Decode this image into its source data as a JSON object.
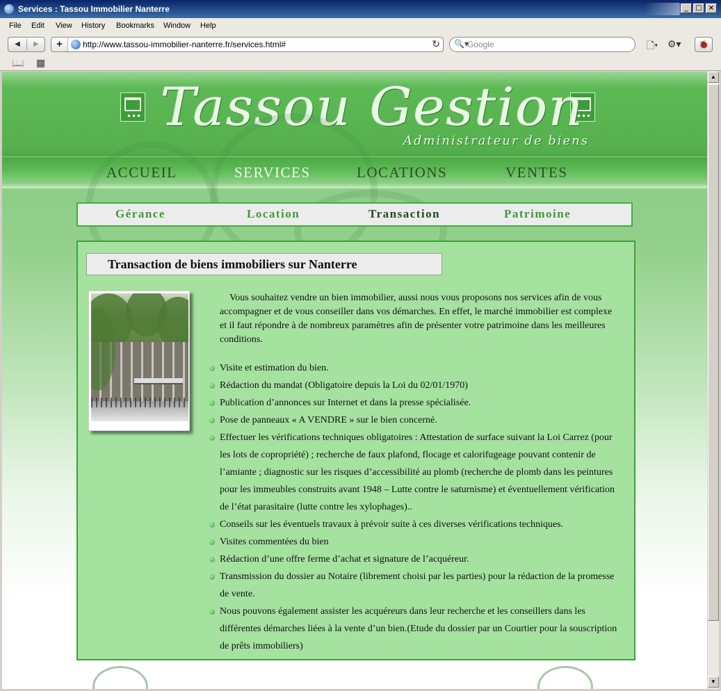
{
  "window": {
    "title": "Services : Tassou Immobilier Nanterre",
    "controls": {
      "minimize": "_",
      "maximize": "□",
      "close": "×"
    }
  },
  "menu": [
    "File",
    "Edit",
    "View",
    "History",
    "Bookmarks",
    "Window",
    "Help"
  ],
  "toolbar": {
    "back_icon": "◀",
    "forward_icon": "▶",
    "add_icon": "+",
    "url": "http://www.tassou-immobilier-nanterre.fr/services.html#",
    "reload_icon": "↻",
    "search_icon": "🔍▾",
    "search_placeholder": "Google",
    "page_icon": "🗋▾",
    "settings_icon": "⚙▾",
    "bug_icon": "🐞"
  },
  "bookmarks": {
    "reader_icon": "📖",
    "grid_icon": "▦"
  },
  "site": {
    "logo_title": "Tassou Gestion",
    "logo_subtitle": "Administrateur de biens",
    "main_nav": [
      "ACCUEIL",
      "SERVICES",
      "LOCATIONS",
      "VENTES"
    ],
    "sub_nav": [
      "Gérance",
      "Location",
      "Transaction",
      "Patrimoine"
    ]
  },
  "content": {
    "heading": "Transaction de biens immobiliers sur Nanterre",
    "intro": "Vous souhaitez vendre un bien immobilier, aussi nous vous proposons nos services afin de vous accompagner et de vous conseiller dans vos démarches. En effet, le marché immobilier est complexe et il faut répondre à de nombreux paramètres afin de présenter votre patrimoine dans les meilleures conditions.",
    "bullets": [
      "Visite et estimation du bien.",
      "Rédaction du mandat (Obligatoire depuis la Loi du 02/01/1970)",
      "Publication d’annonces sur Internet et dans la presse spécialisée.",
      "Pose de panneaux « A VENDRE » sur le bien concerné.",
      "Effectuer les vérifications techniques obligatoires : Attestation de surface suivant la Loi Carrez (pour les lots de copropriété) ; recherche de faux plafond, flocage et calorifugeage pouvant contenir de l’amiante ; diagnostic sur les risques d’accessibilité au plomb (recherche de plomb dans les peintures pour les immeubles construits avant 1948 – Lutte contre le saturnisme) et éventuellement vérification de l’état parasitaire (lutte contre les xylophages)..",
      "Conseils sur les éventuels travaux à prévoir suite à ces diverses vérifications techniques.",
      "Visites commentées du bien",
      "Rédaction d’une offre ferme d’achat et signature de l’acquéreur.",
      "Transmission du dossier au Notaire (librement choisi par les parties) pour la rédaction de la promesse de vente.",
      "Nous pouvons également assister les acquéreurs dans leur recherche et les conseillers dans les différentes démarches liées à la vente d’un bien.(Etude du dossier par un Courtier pour la souscription de prêts immobiliers)"
    ]
  },
  "colors": {
    "header_green": "#55b04d",
    "content_green": "#a5e2a0",
    "border_green": "#3f9f3a",
    "subnav_link": "#3f9a3a",
    "subnav_current": "#1f4a1d"
  }
}
